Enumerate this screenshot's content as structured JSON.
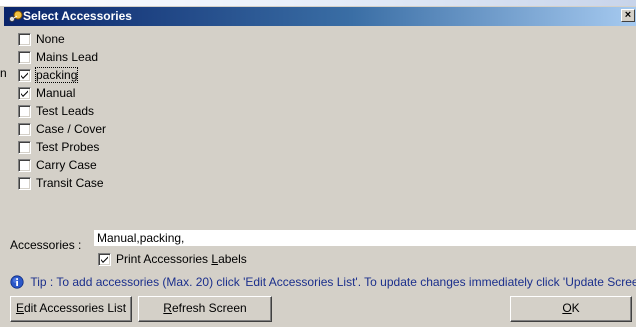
{
  "window": {
    "title": "Select Accessories",
    "close_label": "×"
  },
  "background_fragment": "n",
  "accessories": [
    {
      "label": "None",
      "checked": false
    },
    {
      "label": "Mains Lead",
      "checked": false
    },
    {
      "label": "packing",
      "checked": true,
      "focused": true
    },
    {
      "label": "Manual",
      "checked": true
    },
    {
      "label": "Test Leads",
      "checked": false
    },
    {
      "label": "Case / Cover",
      "checked": false
    },
    {
      "label": "Test Probes",
      "checked": false
    },
    {
      "label": "Carry Case",
      "checked": false
    },
    {
      "label": "Transit Case",
      "checked": false
    }
  ],
  "accessories_field": {
    "label": "Accessories :",
    "value": "Manual,packing,"
  },
  "print_labels": {
    "label_pre": "Print Accessories ",
    "label_accel": "L",
    "label_post": "abels",
    "checked": true
  },
  "tip": {
    "text": "Tip : To add accessories (Max. 20) click 'Edit Accessories List'. To update changes immediately click 'Update Screen'"
  },
  "buttons": {
    "edit": {
      "accel": "E",
      "rest": "dit Accessories List"
    },
    "refresh": {
      "accel": "R",
      "rest": "efresh Screen"
    },
    "ok": {
      "accel": "O",
      "rest": "K"
    }
  },
  "colors": {
    "title_start": "#0a246a",
    "title_end": "#a6caf0",
    "face": "#d4d0c8",
    "tip_text": "#1b2f8c"
  }
}
